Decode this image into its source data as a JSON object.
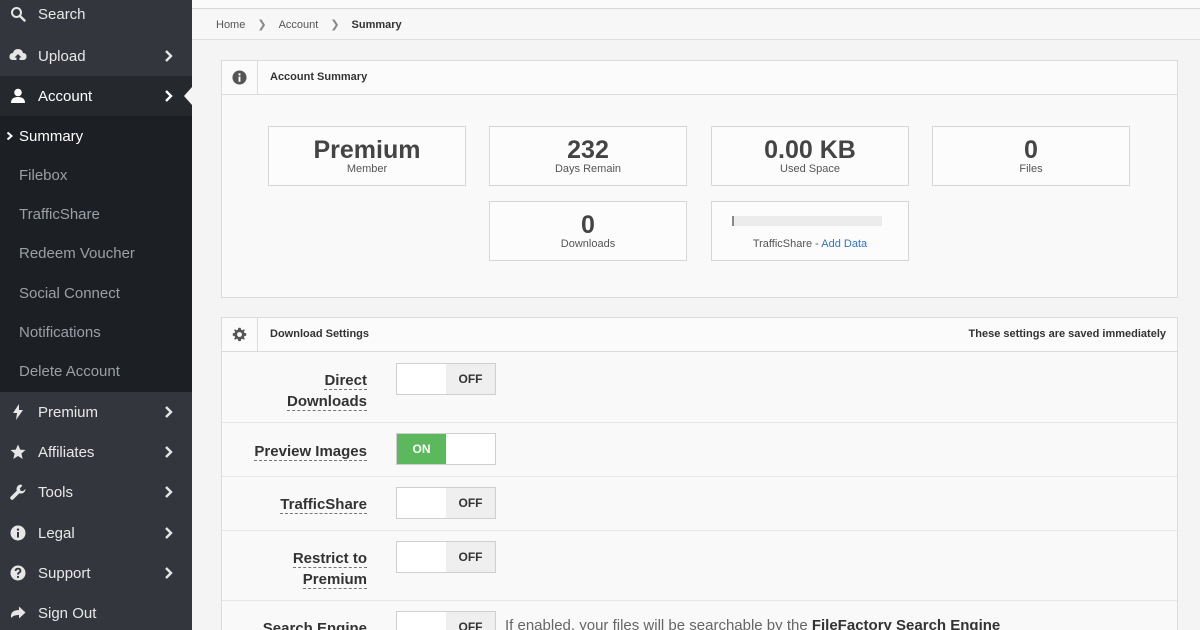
{
  "sidebar": {
    "items": [
      {
        "label": "Search",
        "icon": "search-icon"
      },
      {
        "label": "Upload",
        "icon": "upload-icon"
      },
      {
        "label": "Account",
        "icon": "user-icon"
      },
      {
        "label": "Premium",
        "icon": "bolt-icon"
      },
      {
        "label": "Affiliates",
        "icon": "star-icon"
      },
      {
        "label": "Tools",
        "icon": "wrench-icon"
      },
      {
        "label": "Legal",
        "icon": "info-icon"
      },
      {
        "label": "Support",
        "icon": "question-icon"
      },
      {
        "label": "Sign Out",
        "icon": "sign-out-icon"
      }
    ],
    "account_submenu": [
      "Summary",
      "Filebox",
      "TrafficShare",
      "Redeem Voucher",
      "Social Connect",
      "Notifications",
      "Delete Account"
    ]
  },
  "breadcrumb": [
    "Home",
    "Account",
    "Summary"
  ],
  "account_summary": {
    "title": "Account Summary",
    "stats": [
      {
        "value": "Premium",
        "label": "Member"
      },
      {
        "value": "232",
        "label": "Days Remain"
      },
      {
        "value": "0.00 KB",
        "label": "Used Space"
      },
      {
        "value": "0",
        "label": "Files"
      },
      {
        "value": "0",
        "label": "Downloads"
      }
    ],
    "trafficshare_label": "TrafficShare - ",
    "trafficshare_link": "Add Data"
  },
  "download_settings": {
    "title": "Download Settings",
    "note": "These settings are saved immediately",
    "on_label": "ON",
    "off_label": "OFF",
    "rows": [
      {
        "label_lines": [
          "Direct",
          "Downloads"
        ],
        "state": "off"
      },
      {
        "label_lines": [
          "Preview Images"
        ],
        "state": "on"
      },
      {
        "label_lines": [
          "TrafficShare"
        ],
        "state": "off"
      },
      {
        "label_lines": [
          "Restrict to",
          "Premium"
        ],
        "state": "off"
      },
      {
        "label_lines": [
          "Search Engine"
        ],
        "state": "off"
      }
    ],
    "search_desc_prefix": "If enabled, your files will be searchable by the ",
    "search_desc_bold": "FileFactory Search Engine"
  },
  "colors": {
    "sidebar_bg": "#33373d",
    "submenu_bg": "#1c1f23",
    "toggle_on": "#5cb85c",
    "link": "#2f76c4"
  }
}
